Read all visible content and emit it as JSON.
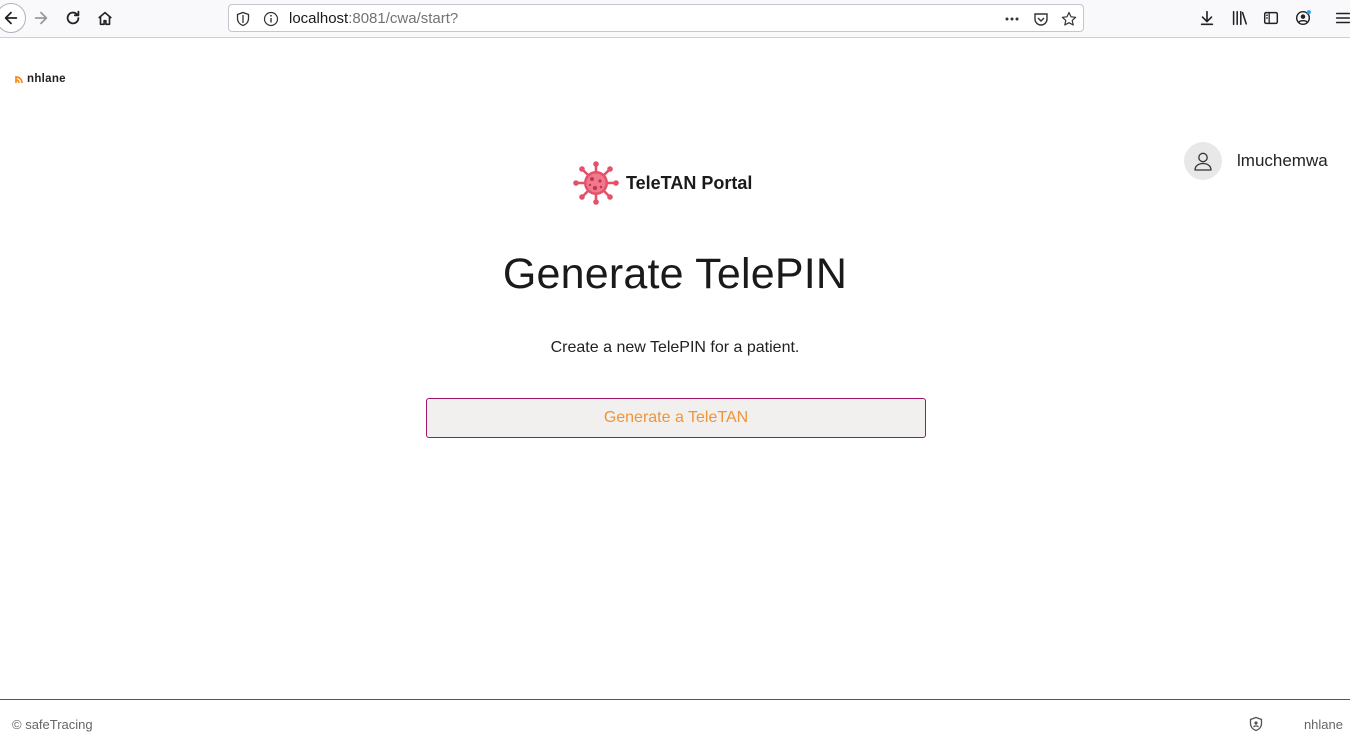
{
  "browser": {
    "url_host": "localhost",
    "url_rest": ":8081/cwa/start?",
    "icons": [
      "back-icon",
      "forward-icon",
      "reload-icon",
      "home-icon",
      "shield-icon",
      "info-icon",
      "more-icon",
      "pocket-icon",
      "star-icon",
      "download-icon",
      "library-icon",
      "sidebar-icon",
      "account-icon",
      "menu-icon"
    ]
  },
  "brand": {
    "logo_text": "nhlane"
  },
  "user": {
    "name": "lmuchemwa"
  },
  "portal": {
    "title": "TeleTAN Portal"
  },
  "main": {
    "heading": "Generate TelePIN",
    "description": "Create a new TelePIN for a patient.",
    "generate_button": "Generate a TeleTAN"
  },
  "footer": {
    "copyright": "© safeTracing",
    "brand": "nhlane"
  },
  "colors": {
    "button_border": "#a0136b",
    "button_text": "#ef9438",
    "virus": "#e4516a"
  }
}
